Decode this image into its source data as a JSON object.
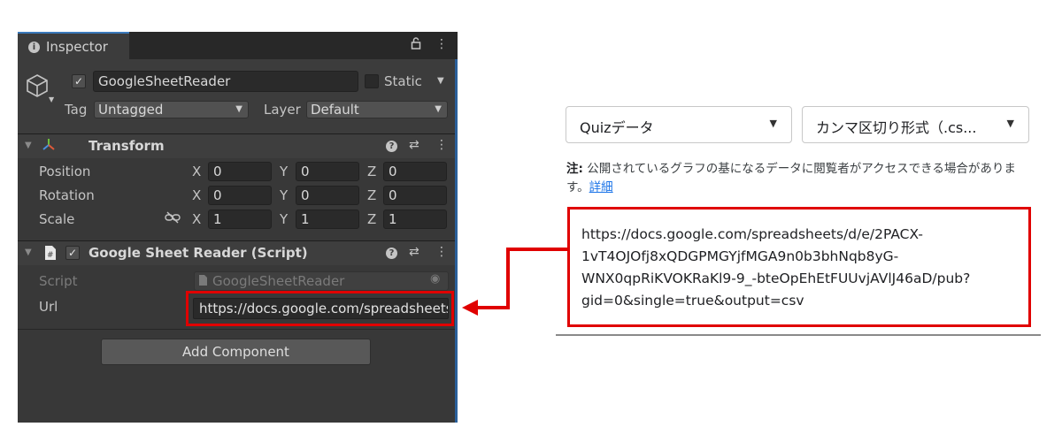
{
  "inspector": {
    "tab_label": "Inspector",
    "gameobject": {
      "name": "GoogleSheetReader",
      "active": true,
      "static_label": "Static",
      "static_checked": false,
      "tag_label": "Tag",
      "tag_value": "Untagged",
      "layer_label": "Layer",
      "layer_value": "Default"
    },
    "transform": {
      "title": "Transform",
      "rows": [
        {
          "label": "Position",
          "x": "0",
          "y": "0",
          "z": "0"
        },
        {
          "label": "Rotation",
          "x": "0",
          "y": "0",
          "z": "0"
        },
        {
          "label": "Scale",
          "x": "1",
          "y": "1",
          "z": "1"
        }
      ],
      "axis_x": "X",
      "axis_y": "Y",
      "axis_z": "Z"
    },
    "script_component": {
      "title": "Google Sheet Reader (Script)",
      "enabled": true,
      "script_label": "Script",
      "script_value": "GoogleSheetReader",
      "url_label": "Url",
      "url_value": "https://docs.google.com/spreadsheets/d/e/2PACX-1vT4OJOfj8xQDGPMGYjfMGA9n0b3bhNqb8yG-WNX0qpRiKVOKRaKl9-9_-bteOpEhEtFUUvjAVlJ46aD/pub?gid=0&single=true&output=csv"
    },
    "add_component_label": "Add Component"
  },
  "publish": {
    "sheet_dropdown": "Quizデータ",
    "format_dropdown": "カンマ区切り形式（.cs...",
    "note_prefix": "注:",
    "note_text": " 公開されているグラフの基になるデータに閲覧者がアクセスできる場合があります。",
    "note_link": "詳細",
    "url_lines": [
      "https://docs.google.com/spreadsheets/d/e/2PACX-",
      "1vT4OJOfj8xQDGPMGYjfMGA9n0b3bhNqb8yG-",
      "WNX0qpRiKVOKRaKl9-9_-bteOpEhEtFUUvjAVlJ46aD/pub?",
      "gid=0&single=true&output=csv"
    ]
  },
  "colors": {
    "highlight_red": "#e00000",
    "unity_panel": "#383838",
    "link_blue": "#1a73e8"
  }
}
